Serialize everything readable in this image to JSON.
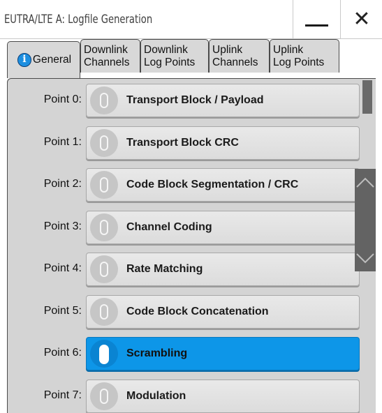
{
  "window": {
    "title": "EUTRA/LTE A: Logfile Generation",
    "minimize_icon": "minimize-icon",
    "close_glyph": "✕"
  },
  "tabs": [
    {
      "id": "general",
      "label": "General",
      "icon": "info-icon",
      "info_glyph": "i",
      "active": true
    },
    {
      "id": "dl-ch",
      "line1": "Downlink",
      "line2": "Channels"
    },
    {
      "id": "dl-lp",
      "line1": "Downlink",
      "line2": "Log Points"
    },
    {
      "id": "ul-ch",
      "line1": "Uplink",
      "line2": "Channels"
    },
    {
      "id": "ul-lp",
      "line1": "Uplink",
      "line2": "Log Points"
    }
  ],
  "points": [
    {
      "label": "Point 0:",
      "text": "Transport Block / Payload",
      "on": false
    },
    {
      "label": "Point 1:",
      "text": "Transport Block CRC",
      "on": false
    },
    {
      "label": "Point 2:",
      "text": "Code Block Segmentation / CRC",
      "on": false
    },
    {
      "label": "Point 3:",
      "text": "Channel Coding",
      "on": false
    },
    {
      "label": "Point 4:",
      "text": "Rate Matching",
      "on": false
    },
    {
      "label": "Point 5:",
      "text": "Code Block Concatenation",
      "on": false
    },
    {
      "label": "Point 6:",
      "text": "Scrambling",
      "on": true
    },
    {
      "label": "Point 7:",
      "text": "Modulation",
      "on": false
    }
  ],
  "colors": {
    "accent_on": "#0d96e8",
    "panel": "#d4d4d4",
    "info_icon": "#1d8fe0"
  },
  "icons": {
    "scroll_up": "chevron-up-icon",
    "scroll_down": "chevron-down-icon"
  }
}
